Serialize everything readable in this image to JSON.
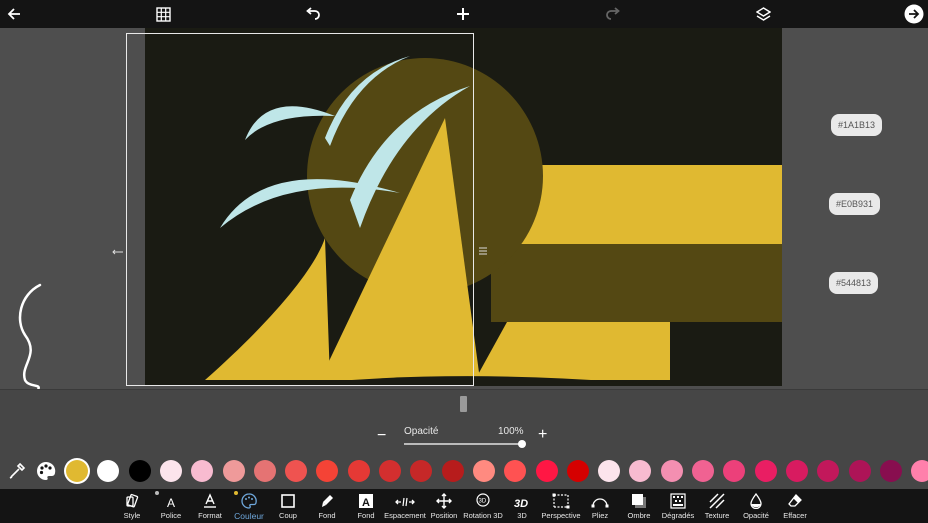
{
  "colors": {
    "primary": "#E0B931",
    "dark": "#1A1B13",
    "olive": "#544813",
    "ice": "#bfe6e8",
    "accent": "#6fa8dc"
  },
  "canvas": {
    "swatch_tags": [
      "#1A1B13",
      "#E0B931",
      "#544813"
    ]
  },
  "opacity": {
    "label": "Opacité",
    "value_text": "100%",
    "value": 1.0,
    "minus": "−",
    "plus": "+"
  },
  "palette": [
    "#E0B931",
    "#FFFFFF",
    "#000000",
    "#FCE4EC",
    "#F8BBD0",
    "#EF9A9A",
    "#E57373",
    "#EF5350",
    "#F44336",
    "#E53935",
    "#D32F2F",
    "#C62828",
    "#B71C1C",
    "#FF8A80",
    "#FF5252",
    "#FF1744",
    "#D50000",
    "#FCE4EC",
    "#F8BBD0",
    "#F48FB1",
    "#F06292",
    "#EC407A",
    "#E91E63",
    "#D81B60",
    "#C2185B",
    "#AD1457",
    "#880E4F",
    "#FF80AB",
    "#FF4081"
  ],
  "tools": [
    {
      "label": "Style",
      "icon": "style-icon"
    },
    {
      "label": "Police",
      "icon": "font-icon"
    },
    {
      "label": "Format",
      "icon": "format-icon"
    },
    {
      "label": "Couleur",
      "icon": "palette-icon"
    },
    {
      "label": "Coup",
      "icon": "stroke-icon"
    },
    {
      "label": "Fond",
      "icon": "brush-icon"
    },
    {
      "label": "Fond",
      "icon": "text-background-icon"
    },
    {
      "label": "Espacement",
      "icon": "spacing-icon"
    },
    {
      "label": "Position",
      "icon": "position-icon"
    },
    {
      "label": "Rotation 3D",
      "icon": "rotation-3d-icon"
    },
    {
      "label": "3D",
      "icon": "three-d-icon"
    },
    {
      "label": "Perspective",
      "icon": "perspective-icon"
    },
    {
      "label": "Pliez",
      "icon": "fold-icon"
    },
    {
      "label": "Ombre",
      "icon": "shadow-icon"
    },
    {
      "label": "Dégradés",
      "icon": "gradient-icon"
    },
    {
      "label": "Texture",
      "icon": "texture-icon"
    },
    {
      "label": "Opacité",
      "icon": "opacity-icon"
    },
    {
      "label": "Effacer",
      "icon": "eraser-icon"
    }
  ],
  "tool_3d_text": "3D",
  "tool_font_text": "A",
  "tool_fond_text": "A"
}
